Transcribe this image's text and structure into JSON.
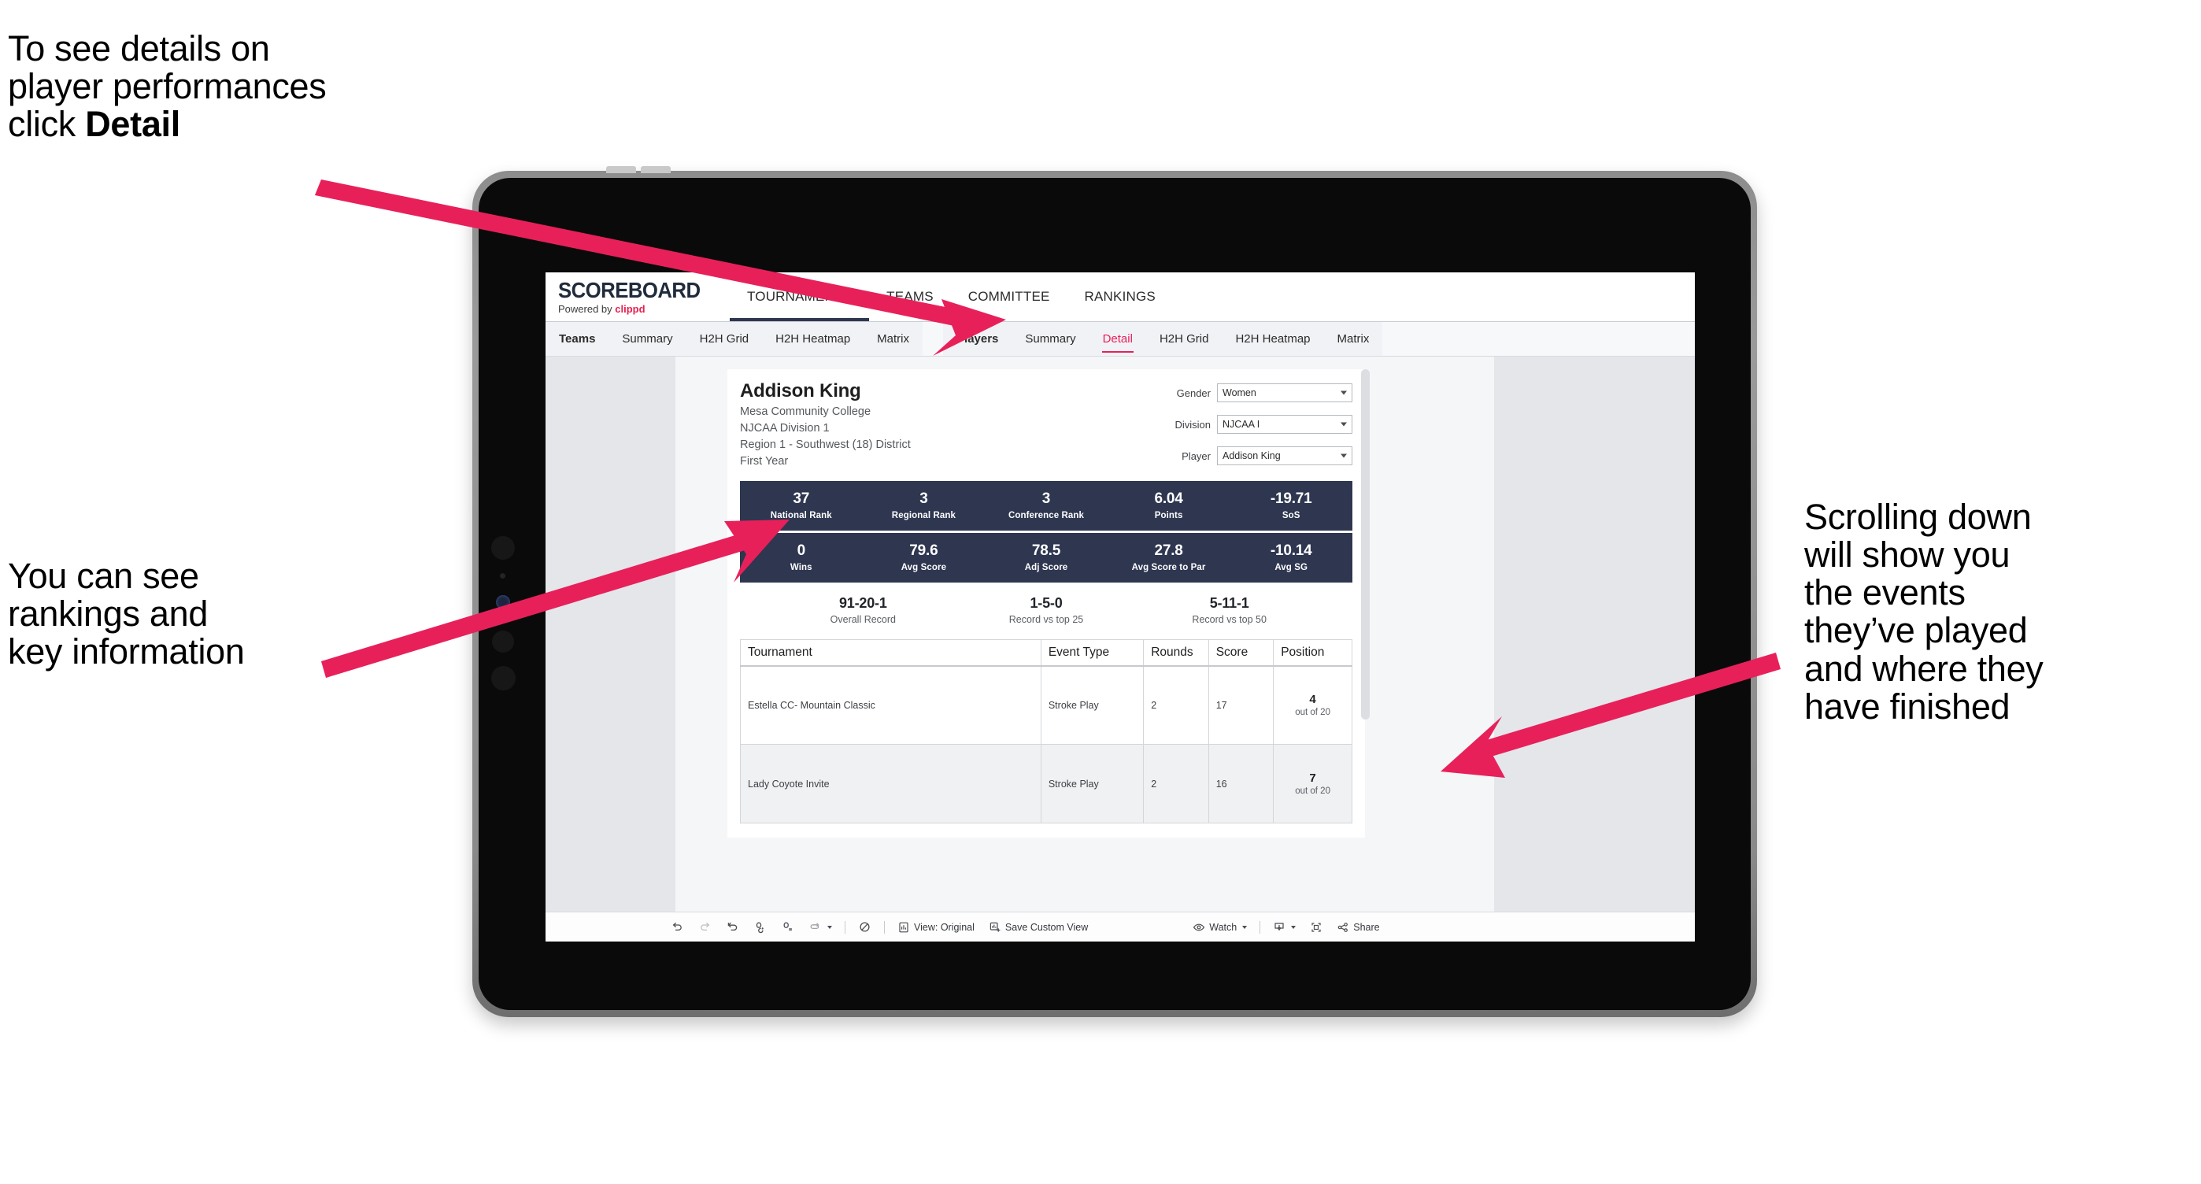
{
  "annotations": {
    "detail_note": "To see details on\nplayer performances\nclick ",
    "detail_note_bold": "Detail",
    "rankings_note": "You can see\nrankings and\nkey information",
    "scroll_note": "Scrolling down\nwill show you\nthe events\nthey’ve played\nand where they\nhave finished",
    "arrow_color": "#E8205A"
  },
  "app": {
    "logo_word": "SCOREBOARD",
    "powered_prefix": "Powered by ",
    "powered_brand": "clippd",
    "main_nav": [
      {
        "label": "TOURNAMENTS",
        "active": true
      },
      {
        "label": "TEAMS",
        "active": false
      },
      {
        "label": "COMMITTEE",
        "active": false
      },
      {
        "label": "RANKINGS",
        "active": false
      }
    ],
    "tabs_teams": [
      {
        "label": "Teams",
        "active": false
      },
      {
        "label": "Summary",
        "active": false
      },
      {
        "label": "H2H Grid",
        "active": false
      },
      {
        "label": "H2H Heatmap",
        "active": false
      },
      {
        "label": "Matrix",
        "active": false
      }
    ],
    "tabs_players": [
      {
        "label": "Players",
        "active": false
      },
      {
        "label": "Summary",
        "active": false
      },
      {
        "label": "Detail",
        "active": true
      },
      {
        "label": "H2H Grid",
        "active": false
      },
      {
        "label": "H2H Heatmap",
        "active": false
      },
      {
        "label": "Matrix",
        "active": false
      }
    ],
    "accent": "#E8205A",
    "navy": "#2E3650"
  },
  "player": {
    "name": "Addison King",
    "school": "Mesa Community College",
    "division": "NJCAA Division 1",
    "region": "Region 1 - Southwest (18) District",
    "year": "First Year"
  },
  "filters": [
    {
      "label": "Gender",
      "value": "Women"
    },
    {
      "label": "Division",
      "value": "NJCAA I"
    },
    {
      "label": "Player",
      "value": "Addison King"
    }
  ],
  "stats_row1": [
    {
      "value": "37",
      "label": "National Rank"
    },
    {
      "value": "3",
      "label": "Regional Rank"
    },
    {
      "value": "3",
      "label": "Conference Rank"
    },
    {
      "value": "6.04",
      "label": "Points"
    },
    {
      "value": "-19.71",
      "label": "SoS"
    }
  ],
  "stats_row2": [
    {
      "value": "0",
      "label": "Wins"
    },
    {
      "value": "79.6",
      "label": "Avg Score"
    },
    {
      "value": "78.5",
      "label": "Adj Score"
    },
    {
      "value": "27.8",
      "label": "Avg Score to Par"
    },
    {
      "value": "-10.14",
      "label": "Avg SG"
    }
  ],
  "records": [
    {
      "value": "91-20-1",
      "label": "Overall Record"
    },
    {
      "value": "1-5-0",
      "label": "Record vs top 25"
    },
    {
      "value": "5-11-1",
      "label": "Record vs top 50"
    }
  ],
  "table": {
    "headers": [
      "Tournament",
      "Event Type",
      "Rounds",
      "Score",
      "Position"
    ],
    "rows": [
      {
        "tournament": "Estella CC- Mountain Classic",
        "event_type": "Stroke Play",
        "rounds": "2",
        "score": "17",
        "position": "4",
        "position_of": "out of 20"
      },
      {
        "tournament": "Lady Coyote Invite",
        "event_type": "Stroke Play",
        "rounds": "2",
        "score": "16",
        "position": "7",
        "position_of": "out of 20"
      }
    ]
  },
  "toolbar": {
    "view_label": "View: Original",
    "save_label": "Save Custom View",
    "watch_label": "Watch",
    "share_label": "Share"
  }
}
